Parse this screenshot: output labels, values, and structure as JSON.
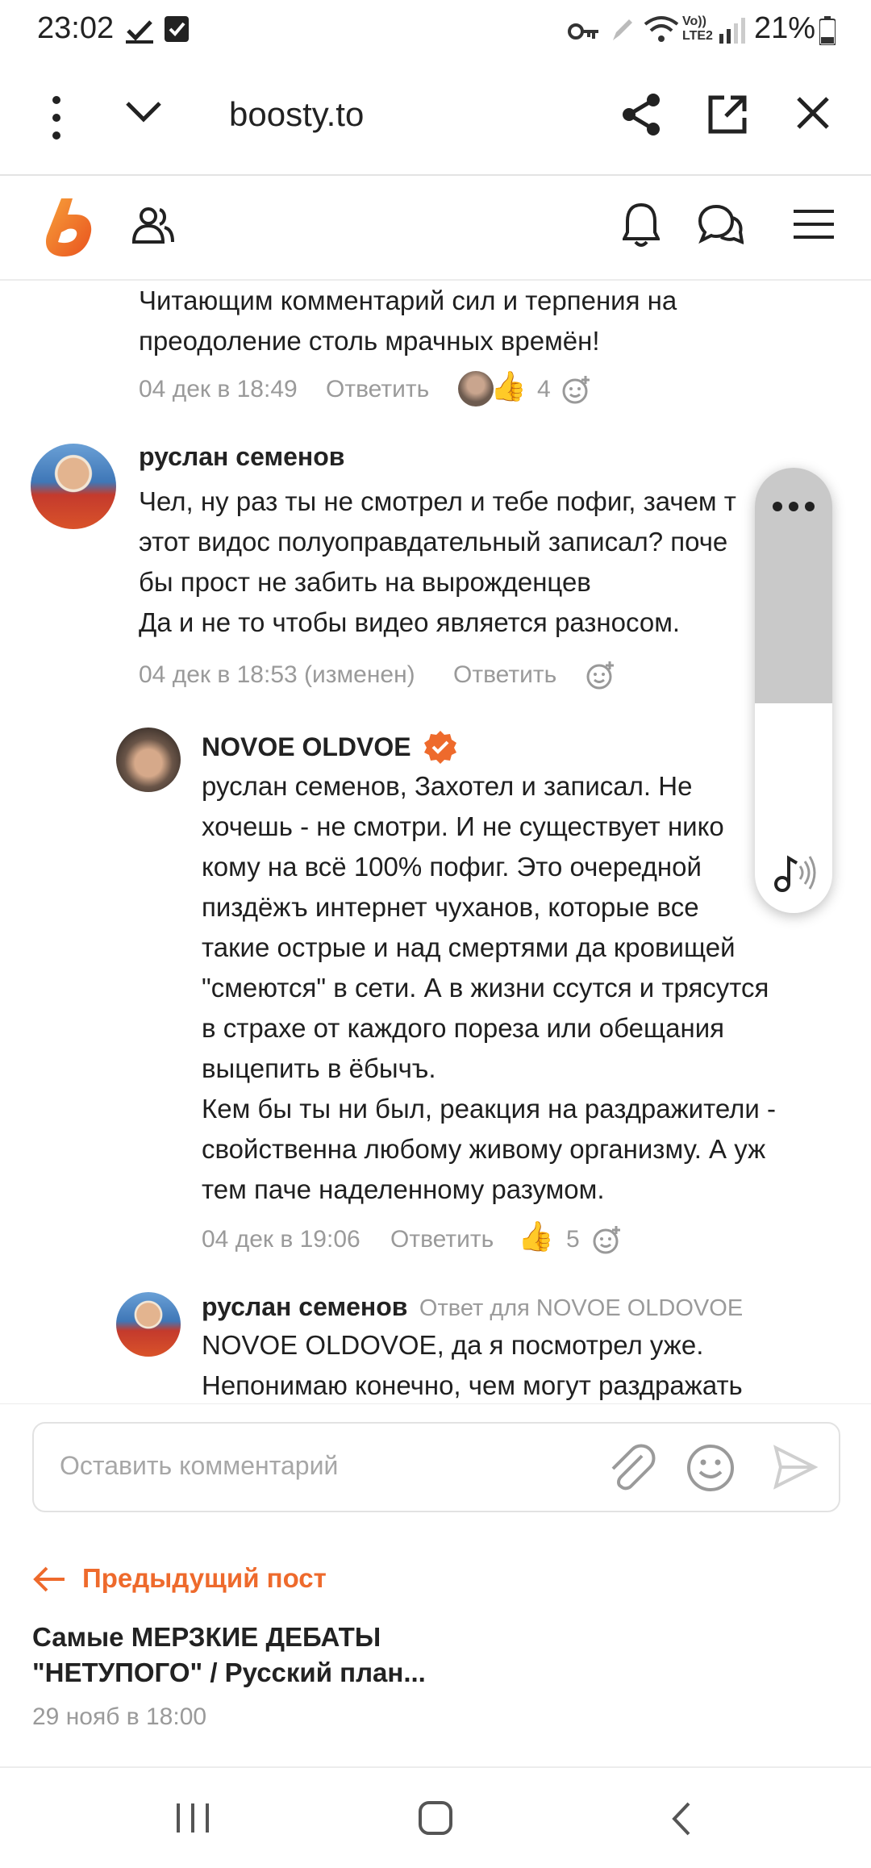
{
  "status_bar": {
    "time": "23:02",
    "battery": "21%",
    "icons": [
      "check-icon",
      "checkbox-icon",
      "key-icon",
      "pen-icon",
      "wifi-icon",
      "volte-icon",
      "signal-icon",
      "battery-icon"
    ],
    "volte_label": "Vo)) LTE2"
  },
  "browser": {
    "url": "boosty.to",
    "icons": [
      "more-vert-icon",
      "chevron-down-icon",
      "share-icon",
      "open-external-icon",
      "close-icon"
    ]
  },
  "site_header": {
    "icons": [
      "boosty-logo-icon",
      "people-icon",
      "bell-icon",
      "chat-icon",
      "menu-icon"
    ],
    "brand_color": "#ee6a2c"
  },
  "comments": [
    {
      "text_lines": [
        "Читающим комментарий сил и терпения на",
        "преодоление столь мрачных времён!"
      ],
      "date": "04 дек в 18:49",
      "reply_label": "Ответить",
      "reaction_count": "4"
    },
    {
      "author": "руслан семенов",
      "text_lines": [
        "Чел, ну раз ты не смотрел и тебе пофиг, зачем т",
        "этот видос полуоправдательный записал? поче",
        "бы прост не забить на вырожденцев",
        "Да и не то чтобы видео является разносом."
      ],
      "date": "04 дек в 18:53 (изменен)",
      "reply_label": "Ответить"
    },
    {
      "author": "NOVOE OLDVOE",
      "text_lines": [
        "руслан семенов, Захотел и записал. Не",
        "хочешь - не смотри. И не существует нико",
        "кому на всё 100% пофиг. Это очередной",
        "пиздёжъ интернет чуханов, которые все",
        "такие острые и над смертями да кровищей",
        "\"смеются\" в сети. А в жизни ссутся и трясутся",
        "в страхе от каждого пореза или обещания",
        "выцепить в ёбычъ.",
        "Кем бы ты ни был, реакция на раздражители -",
        "свойственна любому живому организму. А уж",
        "тем паче наделенному разумом."
      ],
      "date": "04 дек в 19:06",
      "reply_label": "Ответить",
      "reaction_count": "5"
    },
    {
      "author": "руслан семенов",
      "reply_to": "Ответ для NOVOE OLDOVOE",
      "text_lines": [
        "NOVOE OLDOVOE, да я посмотрел уже.",
        "Непонимаю конечно, чем могут раздражать"
      ]
    }
  ],
  "floating_player": {
    "icons": [
      "more-horiz-icon",
      "music-note-icon"
    ]
  },
  "comment_input": {
    "placeholder": "Оставить комментарий",
    "icons": [
      "paperclip-icon",
      "emoji-icon",
      "send-icon"
    ]
  },
  "previous_post": {
    "link_label": "Предыдущий пост",
    "title_lines": [
      "Самые МЕРЗКИЕ ДЕБАТЫ",
      "\"НЕТУПОГО\" / Русский план..."
    ],
    "date": "29 нояб в 18:00"
  },
  "nav_bar": {
    "icons": [
      "recents-icon",
      "home-icon",
      "back-icon"
    ]
  }
}
